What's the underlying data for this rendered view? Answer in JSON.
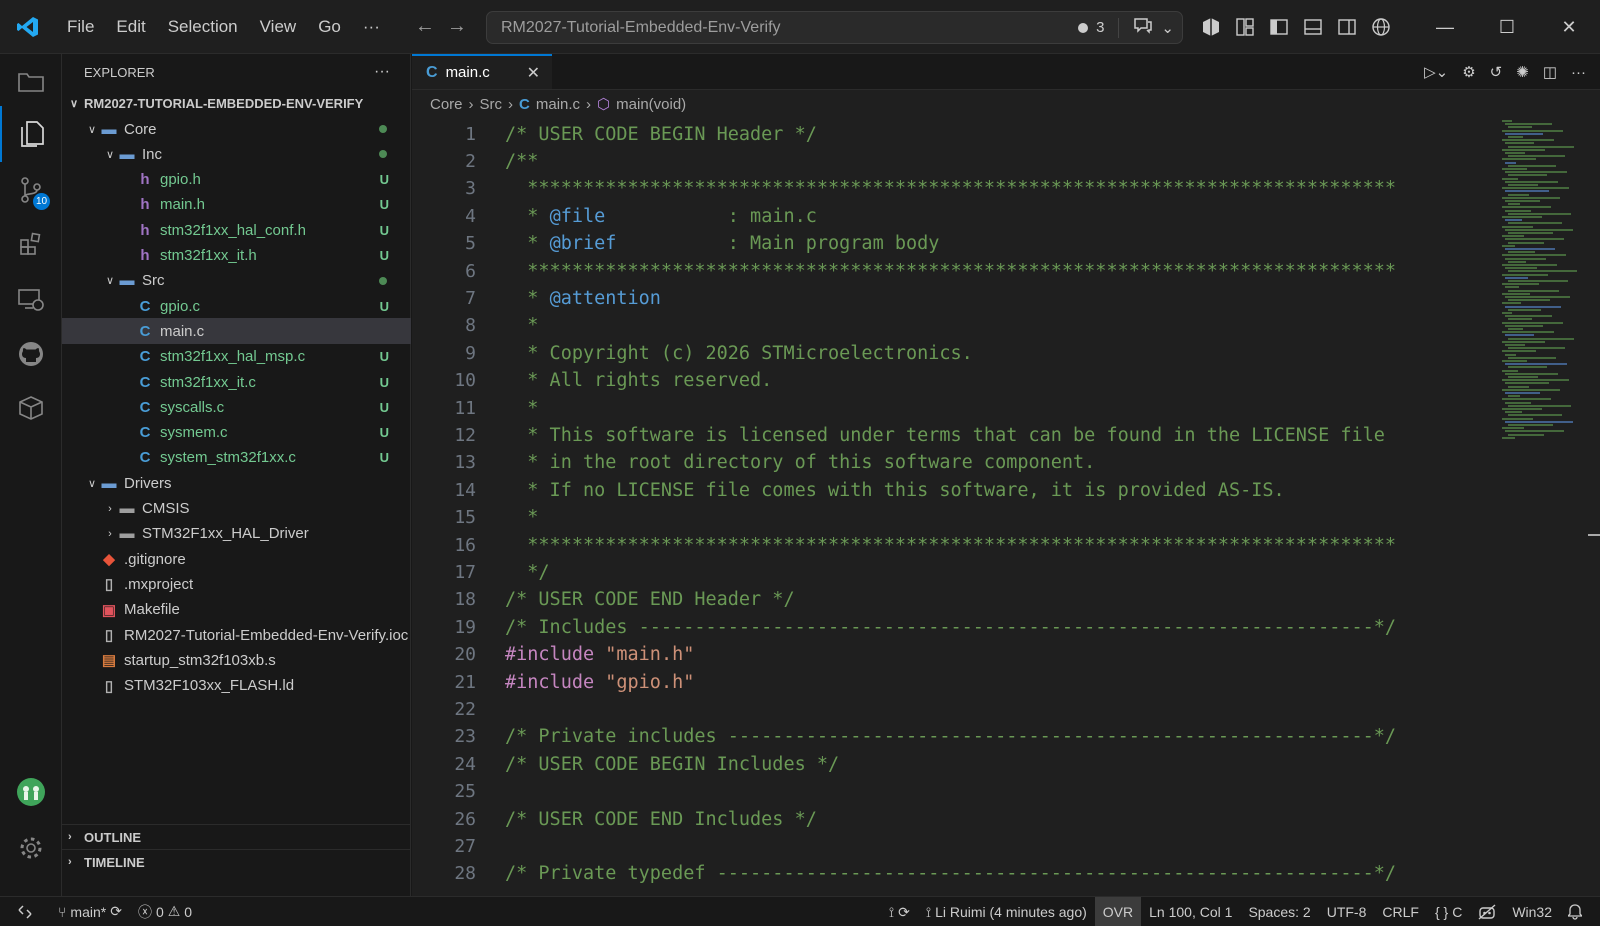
{
  "menu": [
    "File",
    "Edit",
    "Selection",
    "View",
    "Go",
    "···"
  ],
  "command_center": {
    "text": "RM2027-Tutorial-Embedded-Env-Verify",
    "changes_count": "3"
  },
  "activity_badge": "10",
  "explorer": {
    "title": "EXPLORER",
    "more": "···",
    "root": "RM2027-TUTORIAL-EMBEDDED-ENV-VERIFY",
    "items": [
      {
        "label": "Core",
        "kind": "folder-open"
      },
      {
        "label": "Inc",
        "kind": "folder-open"
      },
      {
        "label": "gpio.h",
        "kind": "h",
        "status": "U"
      },
      {
        "label": "main.h",
        "kind": "h",
        "status": "U"
      },
      {
        "label": "stm32f1xx_hal_conf.h",
        "kind": "h",
        "status": "U"
      },
      {
        "label": "stm32f1xx_it.h",
        "kind": "h",
        "status": "U"
      },
      {
        "label": "Src",
        "kind": "folder-open"
      },
      {
        "label": "gpio.c",
        "kind": "c",
        "status": "U"
      },
      {
        "label": "main.c",
        "kind": "c",
        "status": ""
      },
      {
        "label": "stm32f1xx_hal_msp.c",
        "kind": "c",
        "status": "U"
      },
      {
        "label": "stm32f1xx_it.c",
        "kind": "c",
        "status": "U"
      },
      {
        "label": "syscalls.c",
        "kind": "c",
        "status": "U"
      },
      {
        "label": "sysmem.c",
        "kind": "c",
        "status": "U"
      },
      {
        "label": "system_stm32f1xx.c",
        "kind": "c",
        "status": "U"
      },
      {
        "label": "Drivers",
        "kind": "folder-open"
      },
      {
        "label": "CMSIS",
        "kind": "folder"
      },
      {
        "label": "STM32F1xx_HAL_Driver",
        "kind": "folder"
      },
      {
        "label": ".gitignore",
        "kind": "git"
      },
      {
        "label": ".mxproject",
        "kind": "file"
      },
      {
        "label": "Makefile",
        "kind": "make"
      },
      {
        "label": "RM2027-Tutorial-Embedded-Env-Verify.ioc",
        "kind": "file"
      },
      {
        "label": "startup_stm32f103xb.s",
        "kind": "asm"
      },
      {
        "label": "STM32F103xx_FLASH.ld",
        "kind": "file"
      }
    ],
    "outline": "OUTLINE",
    "timeline": "TIMELINE"
  },
  "tab": {
    "label": "main.c"
  },
  "breadcrumb": {
    "p1": "Core",
    "p2": "Src",
    "p3": "main.c",
    "p4": "main(void)"
  },
  "code_lines": [
    {
      "n": "1",
      "t": "/* USER CODE BEGIN Header */"
    },
    {
      "n": "2",
      "t": "/**"
    },
    {
      "n": "3",
      "t": "  ******************************************************************************"
    },
    {
      "n": "4",
      "t": "  * @file           : main.c"
    },
    {
      "n": "5",
      "t": "  * @brief          : Main program body"
    },
    {
      "n": "6",
      "t": "  ******************************************************************************"
    },
    {
      "n": "7",
      "t": "  * @attention"
    },
    {
      "n": "8",
      "t": "  *"
    },
    {
      "n": "9",
      "t": "  * Copyright (c) 2026 STMicroelectronics."
    },
    {
      "n": "10",
      "t": "  * All rights reserved."
    },
    {
      "n": "11",
      "t": "  *"
    },
    {
      "n": "12",
      "t": "  * This software is licensed under terms that can be found in the LICENSE file"
    },
    {
      "n": "13",
      "t": "  * in the root directory of this software component."
    },
    {
      "n": "14",
      "t": "  * If no LICENSE file comes with this software, it is provided AS-IS."
    },
    {
      "n": "15",
      "t": "  *"
    },
    {
      "n": "16",
      "t": "  ******************************************************************************"
    },
    {
      "n": "17",
      "t": "  */"
    },
    {
      "n": "18",
      "t": "/* USER CODE END Header */"
    },
    {
      "n": "19",
      "t": "/* Includes ------------------------------------------------------------------*/"
    },
    {
      "n": "20",
      "t": "#include \"main.h\""
    },
    {
      "n": "21",
      "t": "#include \"gpio.h\""
    },
    {
      "n": "22",
      "t": ""
    },
    {
      "n": "23",
      "t": "/* Private includes ----------------------------------------------------------*/"
    },
    {
      "n": "24",
      "t": "/* USER CODE BEGIN Includes */"
    },
    {
      "n": "25",
      "t": ""
    },
    {
      "n": "26",
      "t": "/* USER CODE END Includes */"
    },
    {
      "n": "27",
      "t": ""
    },
    {
      "n": "28",
      "t": "/* Private typedef -----------------------------------------------------------*/"
    }
  ],
  "status": {
    "branch": "main*",
    "errors": "0",
    "warnings": "0",
    "blame": "Li Ruimi (4 minutes ago)",
    "ovr": "OVR",
    "position": "Ln 100, Col 1",
    "spaces": "Spaces: 2",
    "encoding": "UTF-8",
    "eol": "CRLF",
    "lang": "C",
    "platform": "Win32"
  },
  "colors": {
    "accent": "#0078d4",
    "comment": "#6a9955",
    "keyword": "#c586c0",
    "string": "#ce9178"
  }
}
